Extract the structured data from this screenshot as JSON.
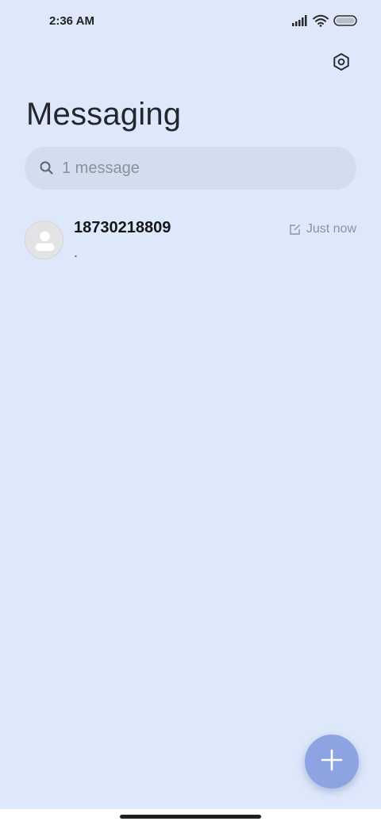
{
  "status_bar": {
    "time": "2:36 AM",
    "icons": [
      "signal-icon",
      "wifi-icon",
      "battery-icon"
    ]
  },
  "header": {
    "title": "Messaging",
    "settings_icon": "settings-icon"
  },
  "search": {
    "placeholder": "1 message",
    "value": ""
  },
  "conversations": [
    {
      "name": "18730218809",
      "snippet": ".",
      "timestamp": "Just now",
      "status_icon": "draft-icon",
      "avatar": "default-avatar-icon"
    }
  ],
  "fab": {
    "icon": "plus-icon",
    "color": "#8ea3e1"
  },
  "colors": {
    "background": "#dde8fb",
    "search_background": "#d3ddee",
    "secondary_text": "#8d939c"
  }
}
